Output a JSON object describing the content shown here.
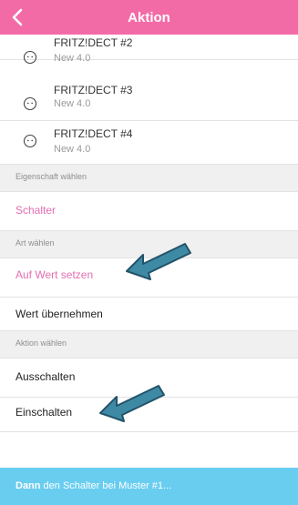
{
  "header": {
    "title": "Aktion",
    "back_icon": "chevron-left-icon",
    "color": "#f36ba6"
  },
  "devices": [
    {
      "name": "FRITZ!DECT #2",
      "version": "New 4.0",
      "icon": "smiley-face-icon"
    },
    {
      "name": "FRITZ!DECT #3",
      "version": "New 4.0",
      "icon": "smiley-face-icon"
    },
    {
      "name": "FRITZ!DECT #4",
      "version": "New 4.0",
      "icon": "smiley-face-icon"
    }
  ],
  "sections": {
    "property": "Eigenschaft wählen",
    "type": "Art wählen",
    "action": "Aktion wählen"
  },
  "rows": {
    "property_value": "Schalter",
    "type_set_value": "Auf Wert setzen",
    "type_take_value": "Wert übernehmen",
    "action_off": "Ausschalten",
    "action_on": "Einschalten"
  },
  "footer": {
    "prefix": "Dann",
    "text": " den Schalter bei Muster #1...",
    "color": "#69cdf0"
  },
  "annotations": {
    "arrow_icon": "teal-arrow-icon",
    "arrow_color": "#3e8aa4"
  },
  "accent_color": "#e36fb0"
}
